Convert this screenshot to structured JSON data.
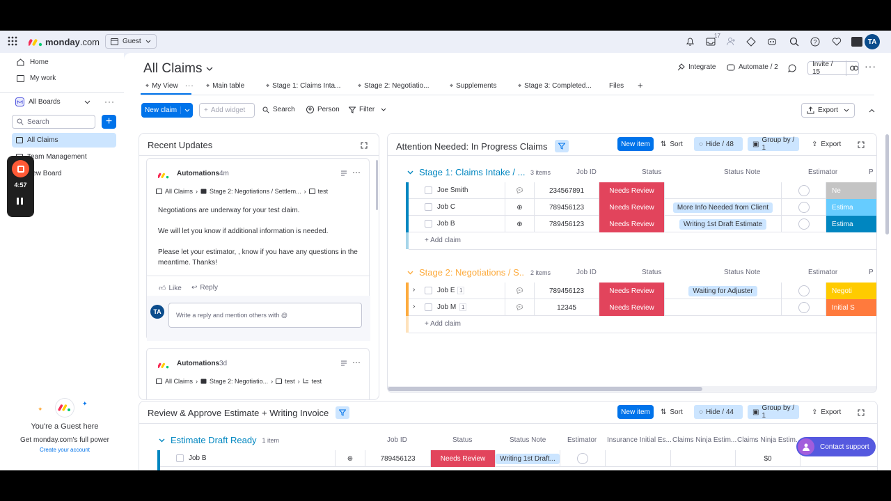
{
  "topbar": {
    "brand": "monday",
    "brand_suffix": ".com",
    "guest_label": "Guest",
    "inbox_count": "17",
    "avatar": "TA"
  },
  "sidebar": {
    "home": "Home",
    "my_work": "My work",
    "workspace": "All Boards",
    "search_placeholder": "Search",
    "items": [
      {
        "label": "All Claims"
      },
      {
        "label": "Team Management"
      },
      {
        "label": "New Board"
      }
    ],
    "recorder_time": "4:57",
    "guest_title": "You're a Guest here",
    "guest_sub": "Get monday.com's full power",
    "guest_link": "Create your account"
  },
  "board": {
    "title": "All Claims",
    "integrate": "Integrate",
    "automate": "Automate / 2",
    "invite": "Invite / 15",
    "tabs": [
      "My View",
      "Main table",
      "Stage 1: Claims Inta...",
      "Stage 2: Negotiatio...",
      "Supplements",
      "Stage 3: Completed...",
      "Files"
    ],
    "toolbar": {
      "new_claim": "New claim",
      "add_widget": "Add widget",
      "search": "Search",
      "person": "Person",
      "filter": "Filter",
      "export": "Export"
    }
  },
  "updates": {
    "title": "Recent Updates",
    "post1": {
      "author": "Automations",
      "time": "4m",
      "crumb1": "All Claims",
      "crumb2": "Stage 2: Negotiations / Settlem...",
      "crumb3": "test",
      "p1": "Negotiations are underway for your test claim.",
      "p2": "We will let you know if additional information is needed.",
      "p3": "Please let your estimator, , know if you have any questions in the meantime. Thanks!",
      "like": "Like",
      "reply": "Reply",
      "reply_avatar": "TA",
      "reply_placeholder": "Write a reply and mention others with @"
    },
    "post2": {
      "author": "Automations",
      "time": "3d",
      "crumb1": "All Claims",
      "crumb2": "Stage 2: Negotiatio...",
      "crumb3": "test",
      "crumb4": "test"
    }
  },
  "attention": {
    "title": "Attention Needed: In Progress Claims",
    "new_item": "New item",
    "sort": "Sort",
    "hide": "Hide / 48",
    "group_by": "Group by / 1",
    "export": "Export",
    "columns": {
      "job_id": "Job ID",
      "status": "Status",
      "status_note": "Status Note",
      "estimator": "Estimator",
      "extra": "P"
    },
    "add_claim": "+ Add claim",
    "groups": [
      {
        "title": "Stage 1: Claims Intake / ...",
        "count": "3 items",
        "color": "#0086c0",
        "rows": [
          {
            "name": "Joe Smith",
            "job_id": "234567891",
            "status": "Needs Review",
            "note": "",
            "stage": "Ne",
            "stage_color": "#c4c4c4"
          },
          {
            "name": "Job C",
            "job_id": "789456123",
            "status": "Needs Review",
            "note": "More Info Needed from Client",
            "stage": "Estima",
            "stage_color": "#66ccff"
          },
          {
            "name": "Job B",
            "job_id": "789456123",
            "status": "Needs Review",
            "note": "Writing 1st Draft Estimate",
            "stage": "Estima",
            "stage_color": "#0086c0"
          }
        ]
      },
      {
        "title": "Stage 2: Negotiations / S...",
        "count": "2 items",
        "color": "#fdab3d",
        "rows": [
          {
            "name": "Job E",
            "sub": "1",
            "job_id": "789456123",
            "status": "Needs Review",
            "note": "Waiting for Adjuster",
            "stage": "Negoti",
            "stage_color": "#ffcb00"
          },
          {
            "name": "Job M",
            "sub": "1",
            "job_id": "12345",
            "status": "Needs Review",
            "note": "",
            "stage": "Initial S",
            "stage_color": "#ff7a3d"
          }
        ]
      }
    ]
  },
  "review": {
    "title": "Review & Approve Estimate + Writing Invoice",
    "new_item": "New item",
    "sort": "Sort",
    "hide": "Hide / 44",
    "group_by": "Group by / 1",
    "export": "Export",
    "group_title": "Estimate Draft Ready",
    "group_count": "1 item",
    "columns": {
      "job_id": "Job ID",
      "status": "Status",
      "status_note": "Status Note",
      "estimator": "Estimator",
      "ins": "Insurance Initial Es...",
      "cn1": "Claims Ninja Estim...",
      "cn2": "Claims Ninja Estim..."
    },
    "row": {
      "name": "Job B",
      "job_id": "789456123",
      "status": "Needs Review",
      "note": "Writing 1st Draft...",
      "amount": "$0"
    },
    "contact_support": "Contact support"
  },
  "colors": {
    "accent": "#0073ea",
    "status_red": "#e2445c",
    "bg": "#eceff8"
  }
}
